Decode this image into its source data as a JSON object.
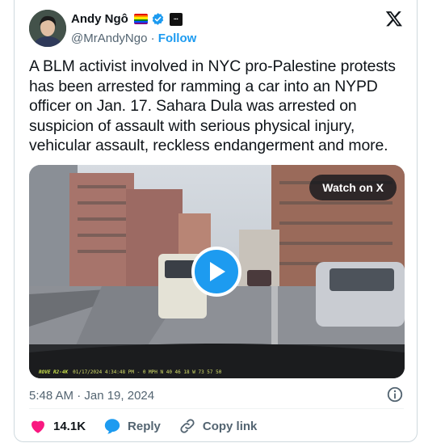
{
  "author": {
    "name": "Andy Ngô",
    "handle": "@MrAndyNgo",
    "separator": " · ",
    "follow_label": "Follow",
    "badge_icon": "pnl-badge-icon"
  },
  "tweet": {
    "text": "A BLM activist involved in NYC pro-Palestine protests has been arrested for ramming a car into an NYPD officer on Jan. 17. Sahara Dula was arrested on suspicion of assault with serious physical injury, vehicular assault, reckless endangerment and more.",
    "timestamp": "5:48 AM · Jan 19, 2024"
  },
  "media": {
    "watch_label": "Watch on X",
    "overlay_brand": "ROVE R2-4K",
    "overlay_text": "01/17/2024  4:34:48 PM -      0 MPH  N 40 46 18  W 73 57 50"
  },
  "actions": {
    "likes": "14.1K",
    "reply_label": "Reply",
    "copy_label": "Copy link"
  },
  "colors": {
    "accent": "#1d9bf0",
    "like": "#f91880",
    "text": "#0f1419",
    "muted": "#536471"
  }
}
